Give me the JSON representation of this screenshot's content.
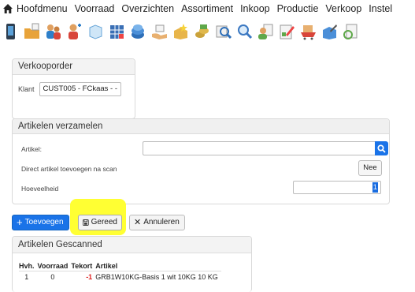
{
  "menu": {
    "items": [
      "Hoofdmenu",
      "Voorraad",
      "Overzichten",
      "Assortiment",
      "Inkoop",
      "Productie",
      "Verkoop",
      "Instel"
    ]
  },
  "toolbar": {
    "icons": [
      "mobile-icon",
      "folder-add-icon",
      "people-icon",
      "person-add-icon",
      "box-icon",
      "grid-icon",
      "stack-icon",
      "hand-box-icon",
      "box-star-icon",
      "coins-icon",
      "magnifier-icon",
      "zoom-icon",
      "person-doc-icon",
      "doc-edit-icon",
      "cart-icon",
      "box-edit-icon",
      "doc-refresh-icon"
    ]
  },
  "verkooporder": {
    "title": "Verkooporder",
    "klant_label": "Klant",
    "klant_value": "CUST005 - FCkaas - -"
  },
  "verzamelen": {
    "title": "Artikelen verzamelen",
    "artikel_label": "Artikel:",
    "artikel_value": "",
    "direct_label": "Direct artikel toevoegen na scan",
    "direct_value": "Nee",
    "hoeveelheid_label": "Hoeveelheid",
    "hoeveelheid_value": "1"
  },
  "actions": {
    "toevoegen": "Toevoegen",
    "gereed": "Gereed",
    "annuleren": "Annuleren"
  },
  "gescanned": {
    "title": "Artikelen Gescanned",
    "columns": [
      "Hvh.",
      "Voorraad",
      "Tekort",
      "Artikel"
    ],
    "rows": [
      {
        "hvh": "1",
        "voorraad": "0",
        "tekort": "-1",
        "artikel": "GRB1W10KG-Basis 1 wit 10KG 10 KG"
      }
    ]
  },
  "colors": {
    "accent": "#1a73e8",
    "highlight": "#ffff33",
    "negative": "#e02020"
  }
}
